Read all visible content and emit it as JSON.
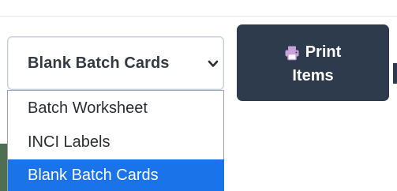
{
  "batch_select": {
    "value": "Blank Batch Cards",
    "chevron_icon": "chevron-down-icon",
    "options": [
      {
        "label": "Batch Worksheet",
        "selected": false
      },
      {
        "label": "INCI Labels",
        "selected": false
      },
      {
        "label": "Blank Batch Cards",
        "selected": true
      }
    ]
  },
  "print_button": {
    "label_line1": "Print",
    "label_line2": "Items",
    "icon": "printer-icon",
    "icon_color": "#c8a2d8",
    "background": "#2e3b4c"
  },
  "colors": {
    "selected_option": "#1a73e8",
    "select_border": "#c6ced6"
  }
}
